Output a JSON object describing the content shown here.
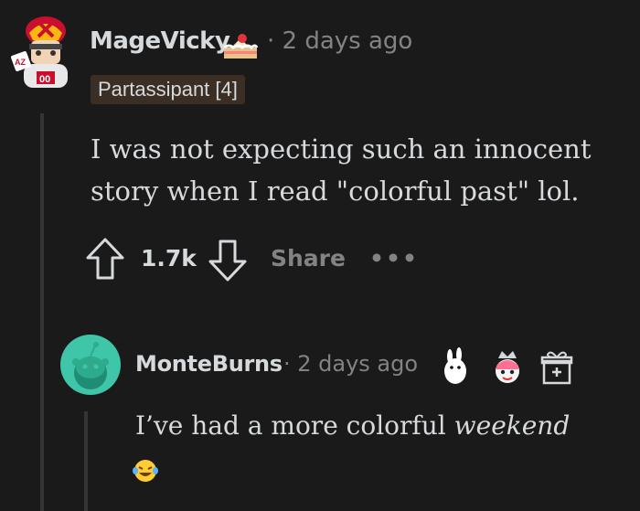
{
  "comment": {
    "username": "MageVicky",
    "time": "· 2 days ago",
    "flair": "Partassipant [4]",
    "body": "I was not expecting such an innocent story when I read \"colorful past\" lol.",
    "score": "1.7k",
    "share_label": "Share",
    "more_label": "•••",
    "icons": {
      "avatar": "football-helmet-avatar-icon",
      "cake": "cake-icon",
      "upvote": "arrow-up-icon",
      "downvote": "arrow-down-icon",
      "more": "more-options-icon"
    }
  },
  "reply": {
    "username": "MonteBurns",
    "time": "· 2 days ago",
    "body_prefix": "I’ve had a more colorful ",
    "body_emphasis": "weekend",
    "icons": {
      "avatar": "snoo-avatar-icon",
      "award1": "rabbit-award-icon",
      "award2": "crown-face-award-icon",
      "gift": "gift-icon",
      "emoji": "laughing-tears-emoji-icon"
    }
  },
  "colors": {
    "background": "#1a1a1b",
    "text": "#d7dadc",
    "muted": "#818384",
    "flair_bg": "#3a2e25",
    "reply_avatar": "#3fc5a8",
    "thread_line": "#343536"
  }
}
